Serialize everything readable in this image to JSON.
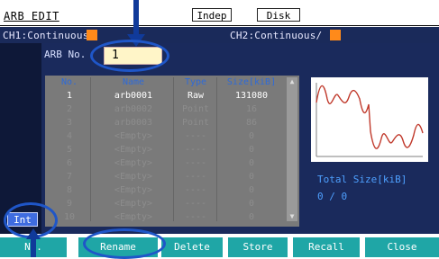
{
  "header": {
    "title": "ARB EDIT",
    "box1": "Indep",
    "box2": "Disk"
  },
  "channels": {
    "ch1": "CH1:Continuous/",
    "ch2": "CH2:Continuous/",
    "marker_color": "#ff8a1a"
  },
  "arb": {
    "label": "ARB No.",
    "value": "1"
  },
  "table": {
    "columns": [
      "No.",
      "Name",
      "Type",
      "Size[kiB]"
    ],
    "rows": [
      {
        "no": "1",
        "name": "arb0001",
        "type": "Raw",
        "size": "131080"
      },
      {
        "no": "2",
        "name": "arb0002",
        "type": "Point",
        "size": "16"
      },
      {
        "no": "3",
        "name": "arb0003",
        "type": "Point",
        "size": "86"
      },
      {
        "no": "4",
        "name": "<Empty>",
        "type": "----",
        "size": "0"
      },
      {
        "no": "5",
        "name": "<Empty>",
        "type": "----",
        "size": "0"
      },
      {
        "no": "6",
        "name": "<Empty>",
        "type": "----",
        "size": "0"
      },
      {
        "no": "7",
        "name": "<Empty>",
        "type": "----",
        "size": "0"
      },
      {
        "no": "8",
        "name": "<Empty>",
        "type": "----",
        "size": "0"
      },
      {
        "no": "9",
        "name": "<Empty>",
        "type": "----",
        "size": "0"
      },
      {
        "no": "10",
        "name": "<Empty>",
        "type": "----",
        "size": "0"
      }
    ]
  },
  "info": {
    "total_label": "Total Size[kiB]",
    "total_value": "0 / 0"
  },
  "left": {
    "int_label": "Int"
  },
  "softkeys": [
    "No.",
    "Rename",
    "Delete",
    "Store",
    "Recall",
    "Close"
  ],
  "colors": {
    "accent": "#1fa6a6",
    "panel": "#1a2a5c",
    "waveform": "#c0392b",
    "annotation": "#1f56c8"
  },
  "icons": [
    "scroll-up-icon",
    "scroll-down-icon",
    "annotation-arrow-icon"
  ]
}
